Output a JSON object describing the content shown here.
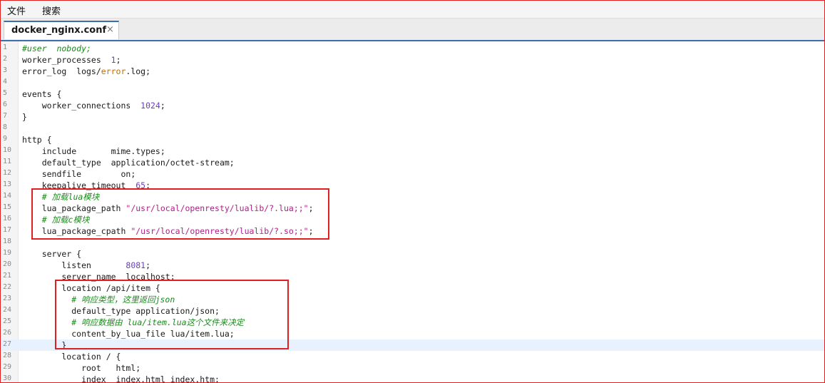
{
  "menu": [
    "文件",
    "搜索"
  ],
  "tab": {
    "title": "docker_nginx.conf",
    "close": "×"
  },
  "lines": [
    {
      "n": "1",
      "code": [
        {
          "t": "#user  nobody;",
          "c": "c"
        }
      ]
    },
    {
      "n": "2",
      "code": [
        {
          "t": "worker_processes  "
        },
        {
          "t": "1",
          "c": "n"
        },
        {
          "t": ";"
        }
      ]
    },
    {
      "n": "3",
      "code": [
        {
          "t": "error_log  logs/"
        },
        {
          "t": "error",
          "c": "k"
        },
        {
          "t": ".log;"
        }
      ]
    },
    {
      "n": "4",
      "code": []
    },
    {
      "n": "5",
      "code": [
        {
          "t": "events {"
        }
      ]
    },
    {
      "n": "6",
      "code": [
        {
          "t": "    worker_connections  "
        },
        {
          "t": "1024",
          "c": "n"
        },
        {
          "t": ";"
        }
      ]
    },
    {
      "n": "7",
      "code": [
        {
          "t": "}"
        }
      ]
    },
    {
      "n": "8",
      "code": []
    },
    {
      "n": "9",
      "code": [
        {
          "t": "http {"
        }
      ]
    },
    {
      "n": "10",
      "code": [
        {
          "t": "    include       mime.types;"
        }
      ]
    },
    {
      "n": "11",
      "code": [
        {
          "t": "    default_type  application/octet-stream;"
        }
      ]
    },
    {
      "n": "12",
      "code": [
        {
          "t": "    sendfile        on;"
        }
      ]
    },
    {
      "n": "13",
      "code": [
        {
          "t": "    keepalive_timeout  "
        },
        {
          "t": "65",
          "c": "n"
        },
        {
          "t": ";"
        }
      ]
    },
    {
      "n": "14",
      "code": [
        {
          "t": "    # 加载lua模块",
          "c": "c"
        }
      ]
    },
    {
      "n": "15",
      "code": [
        {
          "t": "    lua_package_path "
        },
        {
          "t": "\"/usr/local/openresty/lualib/?.lua;;\"",
          "c": "s"
        },
        {
          "t": ";"
        }
      ]
    },
    {
      "n": "16",
      "code": [
        {
          "t": "    # 加载c模块",
          "c": "c"
        }
      ]
    },
    {
      "n": "17",
      "code": [
        {
          "t": "    lua_package_cpath "
        },
        {
          "t": "\"/usr/local/openresty/lualib/?.so;;\"",
          "c": "s"
        },
        {
          "t": ";"
        }
      ]
    },
    {
      "n": "18",
      "code": []
    },
    {
      "n": "19",
      "code": [
        {
          "t": "    server {"
        }
      ]
    },
    {
      "n": "20",
      "code": [
        {
          "t": "        listen       "
        },
        {
          "t": "8081",
          "c": "n"
        },
        {
          "t": ";"
        }
      ]
    },
    {
      "n": "21",
      "code": [
        {
          "t": "        server_name  localhost;"
        }
      ]
    },
    {
      "n": "22",
      "code": [
        {
          "t": "        location /api/item {"
        }
      ]
    },
    {
      "n": "23",
      "code": [
        {
          "t": "          # 响应类型，这里返回json",
          "c": "c"
        }
      ]
    },
    {
      "n": "24",
      "code": [
        {
          "t": "          default_type application/json;"
        }
      ]
    },
    {
      "n": "25",
      "code": [
        {
          "t": "          # 响应数据由 lua/item.lua这个文件来决定",
          "c": "c"
        }
      ]
    },
    {
      "n": "26",
      "code": [
        {
          "t": "          content_by_lua_file lua/item.lua;"
        }
      ]
    },
    {
      "n": "27",
      "code": [
        {
          "t": "        }"
        }
      ]
    },
    {
      "n": "28",
      "code": [
        {
          "t": "        location / {"
        }
      ]
    },
    {
      "n": "29",
      "code": [
        {
          "t": "            root   html;"
        }
      ]
    },
    {
      "n": "30",
      "code": [
        {
          "t": "            index  index.html index.htm;"
        }
      ]
    }
  ],
  "current_line": "27",
  "colors": {
    "highlight_box": "#e02020",
    "comment": "#1a8c1a",
    "string": "#b0208a",
    "number": "#6a3fb8"
  }
}
